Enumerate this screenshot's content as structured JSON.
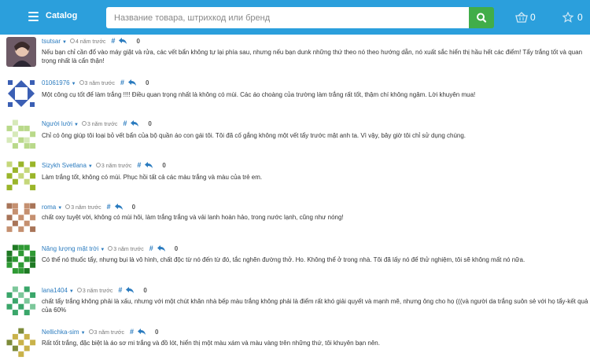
{
  "header": {
    "brand": "Catalog",
    "search_placeholder": "Название товара, штрихкод или бренд",
    "cart_count": "0",
    "favorites_count": "0",
    "bg_color": "#2b9fdc",
    "search_button_color": "#41ad49"
  },
  "comments": [
    {
      "author": "tsutsar",
      "time": "4 năm trước",
      "score": "0",
      "text": "Nếu bạn chỉ cần đổ vào máy giặt và rửa, các vết bẩn không tự lại phía sau, nhưng nếu bạn dunk những thứ theo nó theo hướng dẫn, nó xuất sắc hiển thị hầu hết các điểm! Tẩy trắng tốt và quan trọng nhất là cẩn thận!"
    },
    {
      "author": "01061976",
      "time": "3 năm trước",
      "score": "0",
      "text": "Một công cụ tốt để làm trắng !!!! Điều quan trọng nhất là không có mùi. Các áo choàng của trường làm trắng rất tốt, thậm chí không ngâm. Lời khuyên mua!"
    },
    {
      "author": "Người lười",
      "time": "3 năm trước",
      "score": "0",
      "text": "Chỉ có ông giúp tôi loại bỏ vết bẩn của bộ quần áo con gái tôi. Tôi đã cố gắng không một vết tẩy trước mặt anh ta. Vì vậy, bây giờ tôi chỉ sử dụng chúng."
    },
    {
      "author": "Sizykh Svetlana",
      "time": "3 năm trước",
      "score": "0",
      "text": "Làm trắng tốt, không có mùi. Phục hồi tất cả các màu trắng và màu của trẻ em."
    },
    {
      "author": "roma",
      "time": "3 năm trước",
      "score": "0",
      "text": "chất oxy tuyệt vời, không có mùi hôi, làm trắng trắng và vải lanh hoàn hảo, trong nước lạnh, cũng như nóng!"
    },
    {
      "author": "Năng lượng mặt trời",
      "time": "3 năm trước",
      "score": "0",
      "text": "Có thể nó thuốc tẩy, nhưng bụi là vô hình, chất độc từ nó đến từ đó, tắc nghẽn đường thở. Ho. Không thể ở trong nhà. Tôi đã lấy nó để thử nghiệm, tôi sẽ không mất nó nữa."
    },
    {
      "author": "lana1404",
      "time": "3 năm trước",
      "score": "0",
      "text": "chất tẩy trắng không phải là xấu, nhưng với một chút khăn nhà bếp màu trắng không phải là điểm rất khó giải quyết và mạnh mẽ, nhưng ông cho họ (((và người da trắng suôn sẻ với họ tẩy-kết quả của 60%"
    },
    {
      "author": "Nellichka-sim",
      "time": "3 năm trước",
      "score": "0",
      "text": "Rất tốt trắng, đặc biệt là áo sơ mi trắng và đồ lót, hiển thị một màu xám và màu vàng trên những thứ, tôi khuyên bạn nên."
    }
  ],
  "icons": {
    "menu": "hamburger-icon",
    "search": "search-icon",
    "cart": "basket-icon",
    "favorites": "star-icon",
    "permalink": "hash-icon",
    "reply": "reply-icon",
    "time": "clock-icon"
  }
}
